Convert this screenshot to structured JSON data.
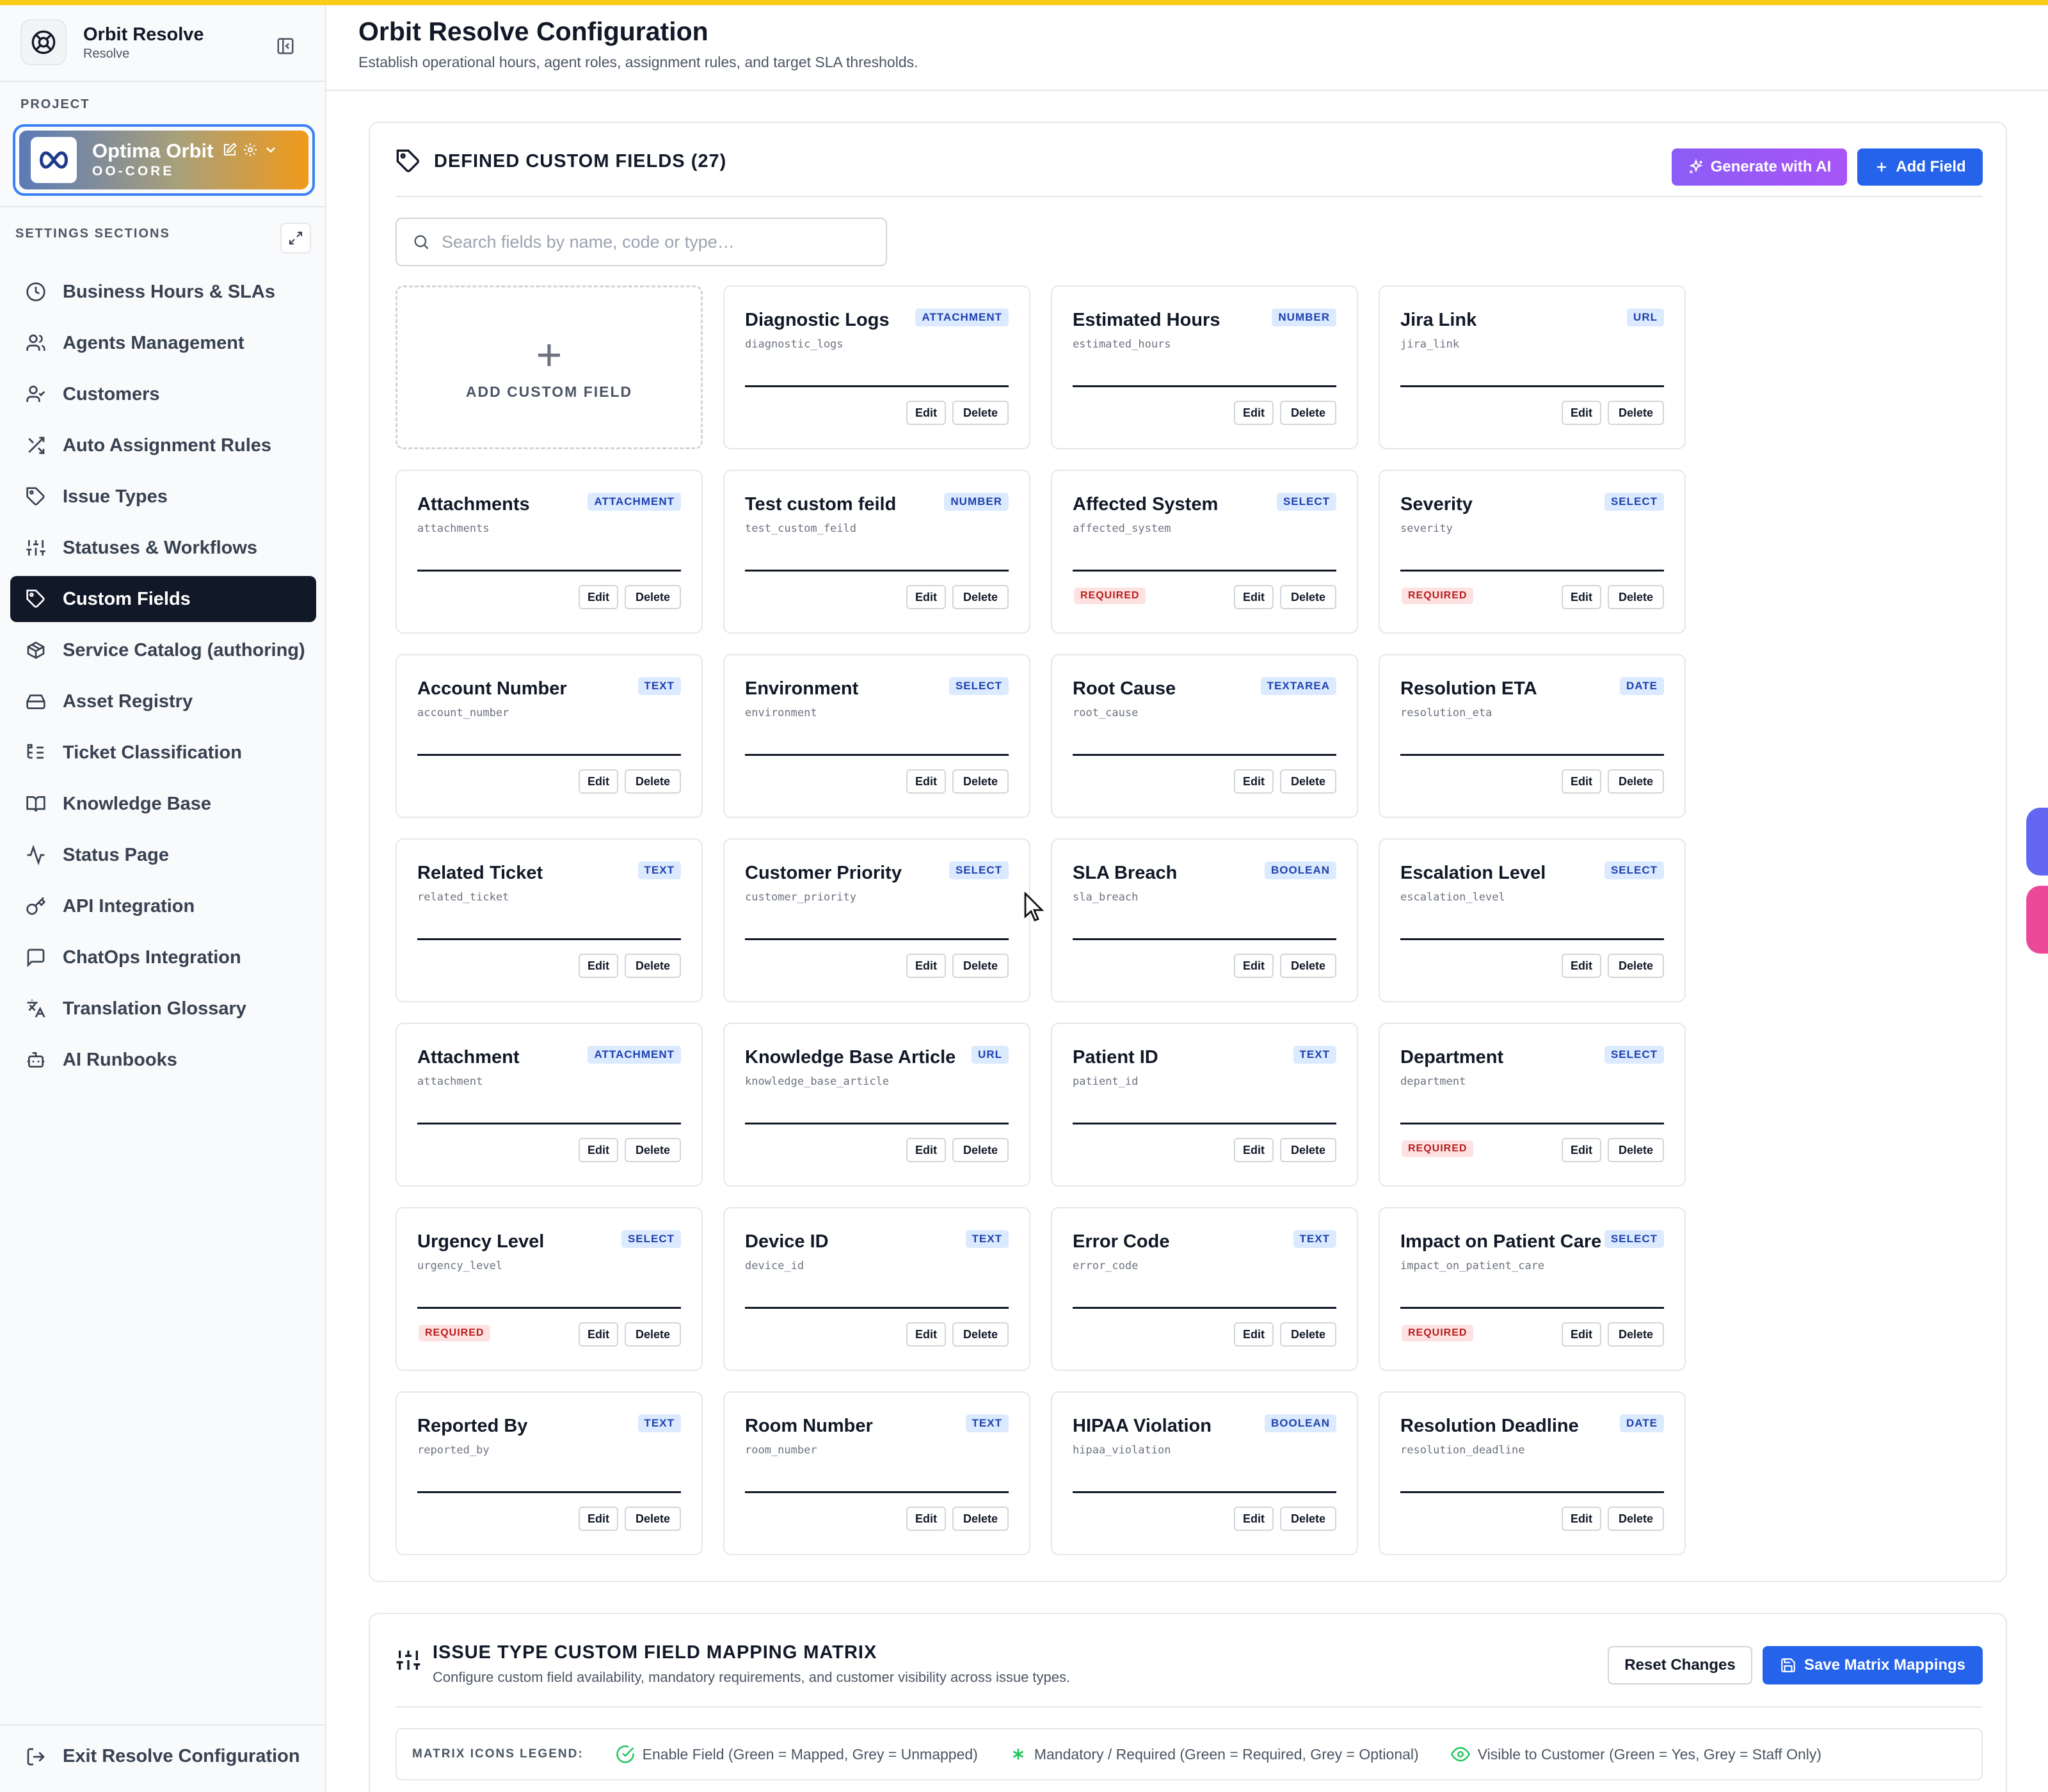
{
  "app": {
    "name": "Orbit Resolve",
    "subtitle": "Resolve"
  },
  "sidebar": {
    "project_label": "PROJECT",
    "project": {
      "name": "Optima Orbit",
      "code": "OO-CORE"
    },
    "sections_label": "SETTINGS SECTIONS",
    "items": [
      {
        "label": "Business Hours & SLAs",
        "icon": "clock-icon"
      },
      {
        "label": "Agents Management",
        "icon": "users-icon"
      },
      {
        "label": "Customers",
        "icon": "user-check-icon"
      },
      {
        "label": "Auto Assignment Rules",
        "icon": "shuffle-icon"
      },
      {
        "label": "Issue Types",
        "icon": "tag-icon"
      },
      {
        "label": "Statuses & Workflows",
        "icon": "sliders-icon"
      },
      {
        "label": "Custom Fields",
        "icon": "tag-icon",
        "active": true
      },
      {
        "label": "Service Catalog (authoring)",
        "icon": "package-icon"
      },
      {
        "label": "Asset Registry",
        "icon": "hard-drive-icon"
      },
      {
        "label": "Ticket Classification",
        "icon": "list-tree-icon"
      },
      {
        "label": "Knowledge Base",
        "icon": "book-icon"
      },
      {
        "label": "Status Page",
        "icon": "activity-icon"
      },
      {
        "label": "API Integration",
        "icon": "key-icon"
      },
      {
        "label": "ChatOps Integration",
        "icon": "message-square-icon"
      },
      {
        "label": "Translation Glossary",
        "icon": "languages-icon"
      },
      {
        "label": "AI Runbooks",
        "icon": "bot-icon"
      }
    ],
    "exit_label": "Exit Resolve Configuration"
  },
  "header": {
    "title": "Orbit Resolve Configuration",
    "subtitle": "Establish operational hours, agent roles, assignment rules, and target SLA thresholds."
  },
  "custom_fields": {
    "title": "DEFINED CUSTOM FIELDS (27)",
    "generate_label": "Generate with AI",
    "add_label": "Add Field",
    "search_placeholder": "Search fields by name, code or type…",
    "add_card_label": "ADD CUSTOM FIELD",
    "edit_label": "Edit",
    "delete_label": "Delete",
    "required_label": "REQUIRED",
    "fields": [
      {
        "name": "Diagnostic Logs",
        "code": "diagnostic_logs",
        "type": "ATTACHMENT",
        "required": false
      },
      {
        "name": "Estimated Hours",
        "code": "estimated_hours",
        "type": "NUMBER",
        "required": false
      },
      {
        "name": "Jira Link",
        "code": "jira_link",
        "type": "URL",
        "required": false
      },
      {
        "name": "Attachments",
        "code": "attachments",
        "type": "ATTACHMENT",
        "required": false
      },
      {
        "name": "Test custom feild",
        "code": "test_custom_feild",
        "type": "NUMBER",
        "required": false
      },
      {
        "name": "Affected System",
        "code": "affected_system",
        "type": "SELECT",
        "required": true
      },
      {
        "name": "Severity",
        "code": "severity",
        "type": "SELECT",
        "required": true
      },
      {
        "name": "Account Number",
        "code": "account_number",
        "type": "TEXT",
        "required": false
      },
      {
        "name": "Environment",
        "code": "environment",
        "type": "SELECT",
        "required": false
      },
      {
        "name": "Root Cause",
        "code": "root_cause",
        "type": "TEXTAREA",
        "required": false
      },
      {
        "name": "Resolution ETA",
        "code": "resolution_eta",
        "type": "DATE",
        "required": false
      },
      {
        "name": "Related Ticket",
        "code": "related_ticket",
        "type": "TEXT",
        "required": false
      },
      {
        "name": "Customer Priority",
        "code": "customer_priority",
        "type": "SELECT",
        "required": false
      },
      {
        "name": "SLA Breach",
        "code": "sla_breach",
        "type": "BOOLEAN",
        "required": false
      },
      {
        "name": "Escalation Level",
        "code": "escalation_level",
        "type": "SELECT",
        "required": false
      },
      {
        "name": "Attachment",
        "code": "attachment",
        "type": "ATTACHMENT",
        "required": false
      },
      {
        "name": "Knowledge Base Article",
        "code": "knowledge_base_article",
        "type": "URL",
        "required": false
      },
      {
        "name": "Patient ID",
        "code": "patient_id",
        "type": "TEXT",
        "required": false
      },
      {
        "name": "Department",
        "code": "department",
        "type": "SELECT",
        "required": true
      },
      {
        "name": "Urgency Level",
        "code": "urgency_level",
        "type": "SELECT",
        "required": true
      },
      {
        "name": "Device ID",
        "code": "device_id",
        "type": "TEXT",
        "required": false
      },
      {
        "name": "Error Code",
        "code": "error_code",
        "type": "TEXT",
        "required": false
      },
      {
        "name": "Impact on Patient Care",
        "code": "impact_on_patient_care",
        "type": "SELECT",
        "required": true
      },
      {
        "name": "Reported By",
        "code": "reported_by",
        "type": "TEXT",
        "required": false
      },
      {
        "name": "Room Number",
        "code": "room_number",
        "type": "TEXT",
        "required": false
      },
      {
        "name": "HIPAA Violation",
        "code": "hipaa_violation",
        "type": "BOOLEAN",
        "required": false
      },
      {
        "name": "Resolution Deadline",
        "code": "resolution_deadline",
        "type": "DATE",
        "required": false
      }
    ]
  },
  "matrix": {
    "title": "ISSUE TYPE CUSTOM FIELD MAPPING MATRIX",
    "subtitle": "Configure custom field availability, mandatory requirements, and customer visibility across issue types.",
    "reset_label": "Reset Changes",
    "save_label": "Save Matrix Mappings",
    "legend_label": "MATRIX ICONS LEGEND:",
    "legend": [
      {
        "icon": "check-circle-icon",
        "text": "Enable Field (Green = Mapped, Grey = Unmapped)"
      },
      {
        "icon": "asterisk-icon",
        "text": "Mandatory / Required (Green = Required, Grey = Optional)"
      },
      {
        "icon": "eye-icon",
        "text": "Visible to Customer (Green = Yes, Grey = Staff Only)"
      }
    ]
  },
  "colors": {
    "accent": "#2563eb",
    "active_nav": "#111827",
    "top_bar": "#facc15",
    "ai_button": "#8b5cf6",
    "type_badge": "#dbeafe",
    "required_badge": "#fee2e2",
    "legend_green": "#22c55e"
  }
}
